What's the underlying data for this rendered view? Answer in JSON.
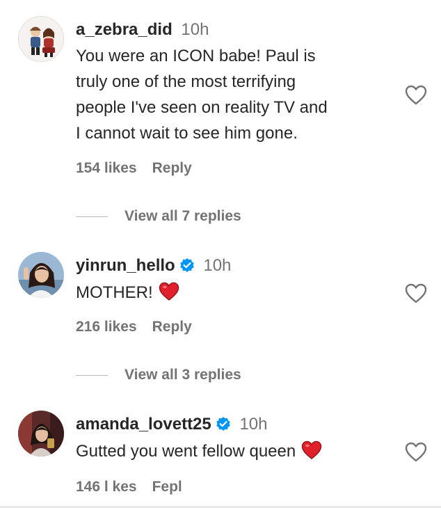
{
  "comments": [
    {
      "username": "a_zebra_did",
      "verified": false,
      "time": "10h",
      "text_lines": [
        "You were an ICON babe! Paul is",
        "truly one of the most terrifying",
        "people I've seen on reality TV and",
        "I cannot wait to see him gone."
      ],
      "likes": "154 likes",
      "reply_label": "Reply",
      "view_replies": "View all 7 replies"
    },
    {
      "username": "yinrun_hello",
      "verified": true,
      "time": "10h",
      "text": "MOTHER!",
      "trailing_emoji": "red-heart",
      "likes": "216 likes",
      "reply_label": "Reply",
      "view_replies": "View all 3 replies"
    },
    {
      "username": "amanda_lovett25",
      "verified": true,
      "time": "10h",
      "text": "Gutted you went fellow queen",
      "trailing_emoji": "red-heart",
      "likes": "146 l kes",
      "reply_label": "Fepl"
    }
  ],
  "icons": {
    "verified": "verified-badge-icon",
    "like": "heart-outline-icon",
    "emoji": "red-heart-emoji-icon"
  },
  "colors": {
    "verified_blue": "#0095f6",
    "heart_red": "#e0202a",
    "secondary_text": "#737373",
    "primary_text": "#262626"
  }
}
